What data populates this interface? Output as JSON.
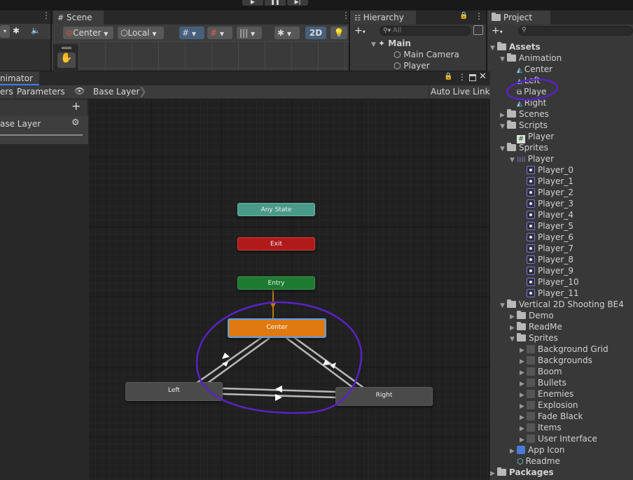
{
  "toolbar": {
    "play_icon": "play-icon",
    "pause_icon": "pause-icon",
    "step_icon": "step-icon"
  },
  "scene": {
    "tab_label": "Scene",
    "pivot_label": "Center",
    "space_label": "Local",
    "mode_2d": "2D"
  },
  "hierarchy": {
    "tab_label": "Hierarchy",
    "search_placeholder": "All",
    "items": [
      {
        "label": "Main"
      },
      {
        "label": "Main Camera"
      },
      {
        "label": "Player"
      }
    ]
  },
  "animator": {
    "tab_label": "nimator",
    "tabs": [
      "ers",
      "Parameters"
    ],
    "breadcrumb": "Base Layer",
    "auto_live_link": "Auto Live Link",
    "layer_name": "ase Layer",
    "nodes": {
      "any_state": "Any State",
      "exit": "Exit",
      "entry": "Entry",
      "center": "Center",
      "left": "Left",
      "right": "Right"
    }
  },
  "project": {
    "tab_label": "Project",
    "tree": [
      {
        "label": "Assets",
        "depth": 0,
        "bold": true,
        "arrow": "down",
        "icon": "folder"
      },
      {
        "label": "Animation",
        "depth": 1,
        "arrow": "down",
        "icon": "folder"
      },
      {
        "label": "Center",
        "depth": 2,
        "icon": "anim"
      },
      {
        "label": "Left",
        "depth": 2,
        "icon": "anim"
      },
      {
        "label": "Playe",
        "depth": 2,
        "icon": "controller"
      },
      {
        "label": "Right",
        "depth": 2,
        "icon": "anim"
      },
      {
        "label": "Scenes",
        "depth": 1,
        "arrow": "right",
        "icon": "folder"
      },
      {
        "label": "Scripts",
        "depth": 1,
        "arrow": "down",
        "icon": "folder"
      },
      {
        "label": "Player",
        "depth": 2,
        "icon": "script"
      },
      {
        "label": "Sprites",
        "depth": 1,
        "arrow": "down",
        "icon": "folder"
      },
      {
        "label": "Player",
        "depth": 2,
        "arrow": "down",
        "icon": "spritesheet"
      },
      {
        "label": "Player_0",
        "depth": 3,
        "icon": "sprite"
      },
      {
        "label": "Player_1",
        "depth": 3,
        "icon": "sprite"
      },
      {
        "label": "Player_2",
        "depth": 3,
        "icon": "sprite"
      },
      {
        "label": "Player_3",
        "depth": 3,
        "icon": "sprite"
      },
      {
        "label": "Player_4",
        "depth": 3,
        "icon": "sprite"
      },
      {
        "label": "Player_5",
        "depth": 3,
        "icon": "sprite"
      },
      {
        "label": "Player_6",
        "depth": 3,
        "icon": "sprite"
      },
      {
        "label": "Player_7",
        "depth": 3,
        "icon": "sprite"
      },
      {
        "label": "Player_8",
        "depth": 3,
        "icon": "sprite"
      },
      {
        "label": "Player_9",
        "depth": 3,
        "icon": "sprite"
      },
      {
        "label": "Player_10",
        "depth": 3,
        "icon": "sprite"
      },
      {
        "label": "Player_11",
        "depth": 3,
        "icon": "sprite"
      },
      {
        "label": "Vertical 2D Shooting BE4",
        "depth": 1,
        "arrow": "down",
        "icon": "folder"
      },
      {
        "label": "Demo",
        "depth": 2,
        "arrow": "right",
        "icon": "folder"
      },
      {
        "label": "ReadMe",
        "depth": 2,
        "arrow": "right",
        "icon": "folder"
      },
      {
        "label": "Sprites",
        "depth": 2,
        "arrow": "down",
        "icon": "folder"
      },
      {
        "label": "Background Grid",
        "depth": 3,
        "arrow": "right",
        "icon": "thumb"
      },
      {
        "label": "Backgrounds",
        "depth": 3,
        "arrow": "right",
        "icon": "thumb"
      },
      {
        "label": "Boom",
        "depth": 3,
        "arrow": "right",
        "icon": "thumb"
      },
      {
        "label": "Bullets",
        "depth": 3,
        "arrow": "right",
        "icon": "thumb"
      },
      {
        "label": "Enemies",
        "depth": 3,
        "arrow": "right",
        "icon": "thumb"
      },
      {
        "label": "Explosion",
        "depth": 3,
        "arrow": "right",
        "icon": "thumb"
      },
      {
        "label": "Fade Black",
        "depth": 3,
        "arrow": "right",
        "icon": "thumb"
      },
      {
        "label": "Items",
        "depth": 3,
        "arrow": "right",
        "icon": "thumb"
      },
      {
        "label": "User Interface",
        "depth": 3,
        "arrow": "right",
        "icon": "thumb"
      },
      {
        "label": "App Icon",
        "depth": 2,
        "arrow": "right",
        "icon": "appicon"
      },
      {
        "label": "Readme",
        "depth": 2,
        "icon": "readme"
      },
      {
        "label": "Packages",
        "depth": 0,
        "bold": true,
        "arrow": "right",
        "icon": "folder"
      }
    ]
  },
  "colors": {
    "center_node": "#e07a10",
    "any_state_node": "#4a9a8a",
    "exit_node": "#b01a1a",
    "entry_node": "#1d7a30",
    "annotation": "#5a22c8"
  }
}
